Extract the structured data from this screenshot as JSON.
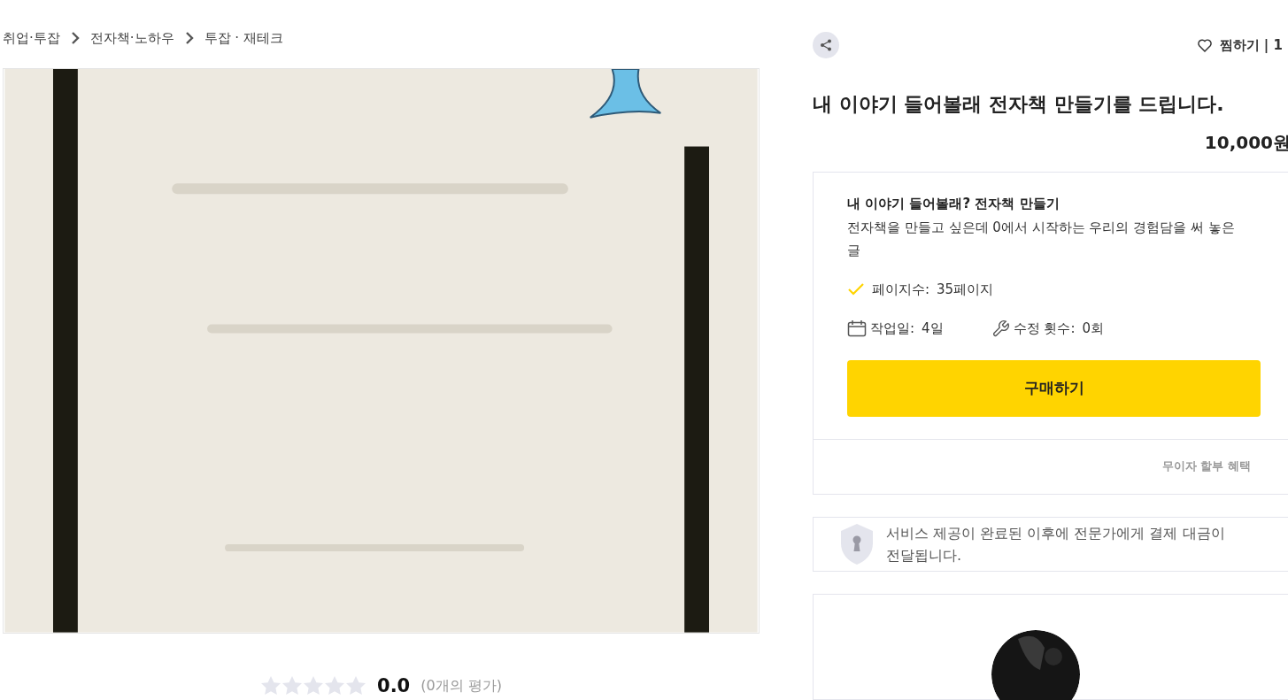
{
  "breadcrumb": [
    "취업·투잡",
    "전자책·노하우",
    "투잡 · 재테크"
  ],
  "rating": {
    "stars": 0,
    "score": "0.0",
    "count": "(0개의 평가)"
  },
  "wish": {
    "label": "찜하기 | 1"
  },
  "title": "내 이야기 들어볼래 전자책 만들기를 드립니다.",
  "price": "10,000원",
  "package": {
    "name": "내 이야기 들어볼래? 전자책 만들기",
    "description": "전자책을 만들고 싶은데 0에서 시작하는 우리의 경험담을 써 놓은 글",
    "specs": [
      {
        "kind": "check",
        "label": "페이지수:",
        "value": "35페이지"
      }
    ],
    "meta": [
      {
        "kind": "calendar",
        "label": "작업일:",
        "value": "4일"
      },
      {
        "kind": "wrench",
        "label": "수정 횟수:",
        "value": "0회"
      }
    ],
    "buy_button": "구매하기",
    "installment": "무이자 할부 혜택"
  },
  "notice": "서비스 제공이 완료된 이후에 전문가에게 결제 대금이 전달됩니다."
}
